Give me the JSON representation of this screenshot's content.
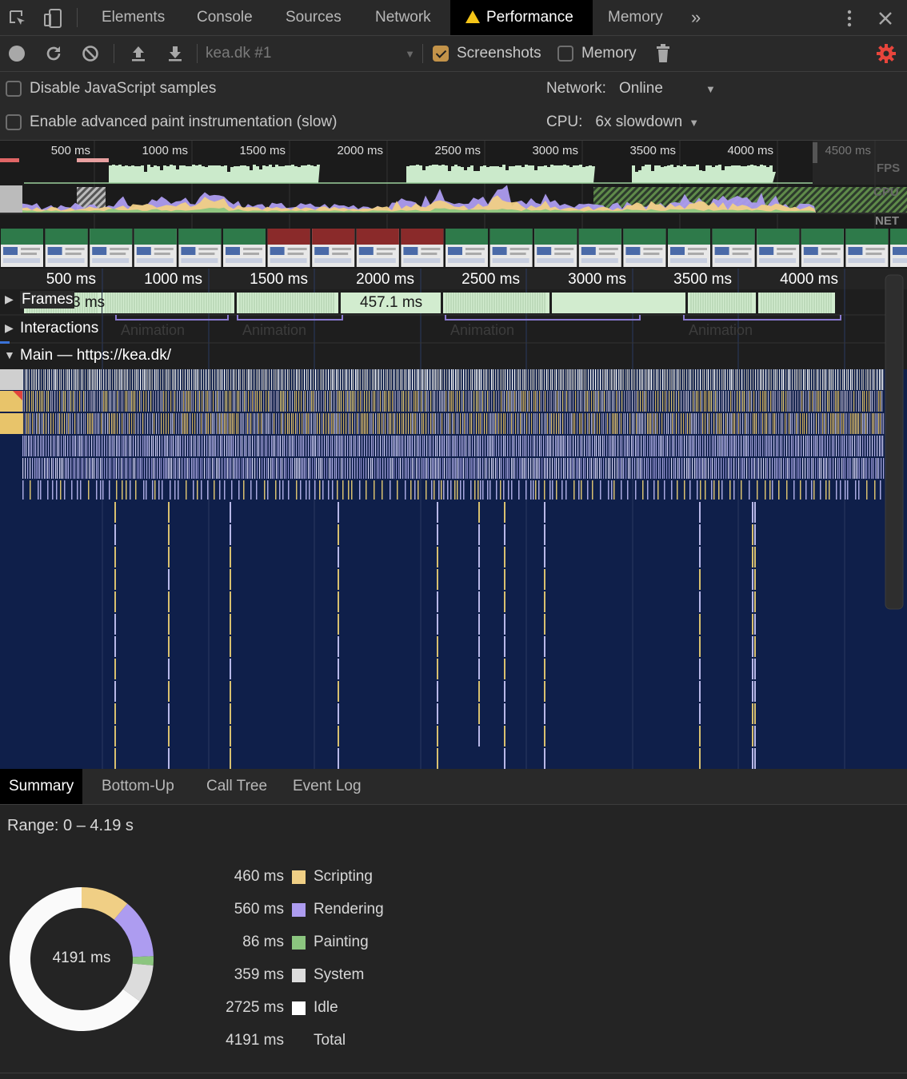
{
  "tabs": {
    "elements": "Elements",
    "console": "Console",
    "sources": "Sources",
    "network": "Network",
    "performance": "Performance",
    "memory": "Memory",
    "more": "»"
  },
  "toolbar": {
    "profile_select": "kea.dk #1",
    "screenshots_label": "Screenshots",
    "screenshots_checked": true,
    "memory_label": "Memory",
    "memory_checked": false
  },
  "settings": {
    "disable_js_samples": "Disable JavaScript samples",
    "advanced_paint": "Enable advanced paint instrumentation (slow)",
    "network_label": "Network:",
    "network_value": "Online",
    "cpu_label": "CPU:",
    "cpu_value": "6x slowdown"
  },
  "overview": {
    "ticks": [
      "500 ms",
      "1000 ms",
      "1500 ms",
      "2000 ms",
      "2500 ms",
      "3000 ms",
      "3500 ms",
      "4000 ms",
      "4500 ms"
    ],
    "fps_label": "FPS",
    "cpu_label": "CPU",
    "net_label": "NET"
  },
  "timeline": {
    "ticks": [
      "500 ms",
      "1000 ms",
      "1500 ms",
      "2000 ms",
      "2500 ms",
      "3000 ms",
      "3500 ms",
      "4000 ms"
    ],
    "frames_label": "Frames",
    "frames_partial": "3 ms",
    "frame_duration": "457.1 ms",
    "interactions_label": "Interactions",
    "animation_label": "Animation",
    "main_label": "Main — https://kea.dk/"
  },
  "bottom": {
    "tabs": [
      "Summary",
      "Bottom-Up",
      "Call Tree",
      "Event Log"
    ],
    "range": "Range: 0 – 4.19 s",
    "total_center": "4191 ms",
    "summary": [
      {
        "ms": "460 ms",
        "name": "Scripting",
        "value": 460,
        "color": "#f0cf85"
      },
      {
        "ms": "560 ms",
        "name": "Rendering",
        "value": 560,
        "color": "#ad9cf0"
      },
      {
        "ms": "86 ms",
        "name": "Painting",
        "value": 86,
        "color": "#8bc57f"
      },
      {
        "ms": "359 ms",
        "name": "System",
        "value": 359,
        "color": "#dcdcdc"
      },
      {
        "ms": "2725 ms",
        "name": "Idle",
        "value": 2725,
        "color": "#ffffff"
      }
    ],
    "total_row": {
      "ms": "4191 ms",
      "name": "Total"
    }
  },
  "colors": {
    "accent_active_tab": "#000000",
    "warning": "#f5c518",
    "gear": "#e8453c",
    "fps_green": "#cbeacb",
    "flame_bg": "#0f1f4a"
  }
}
